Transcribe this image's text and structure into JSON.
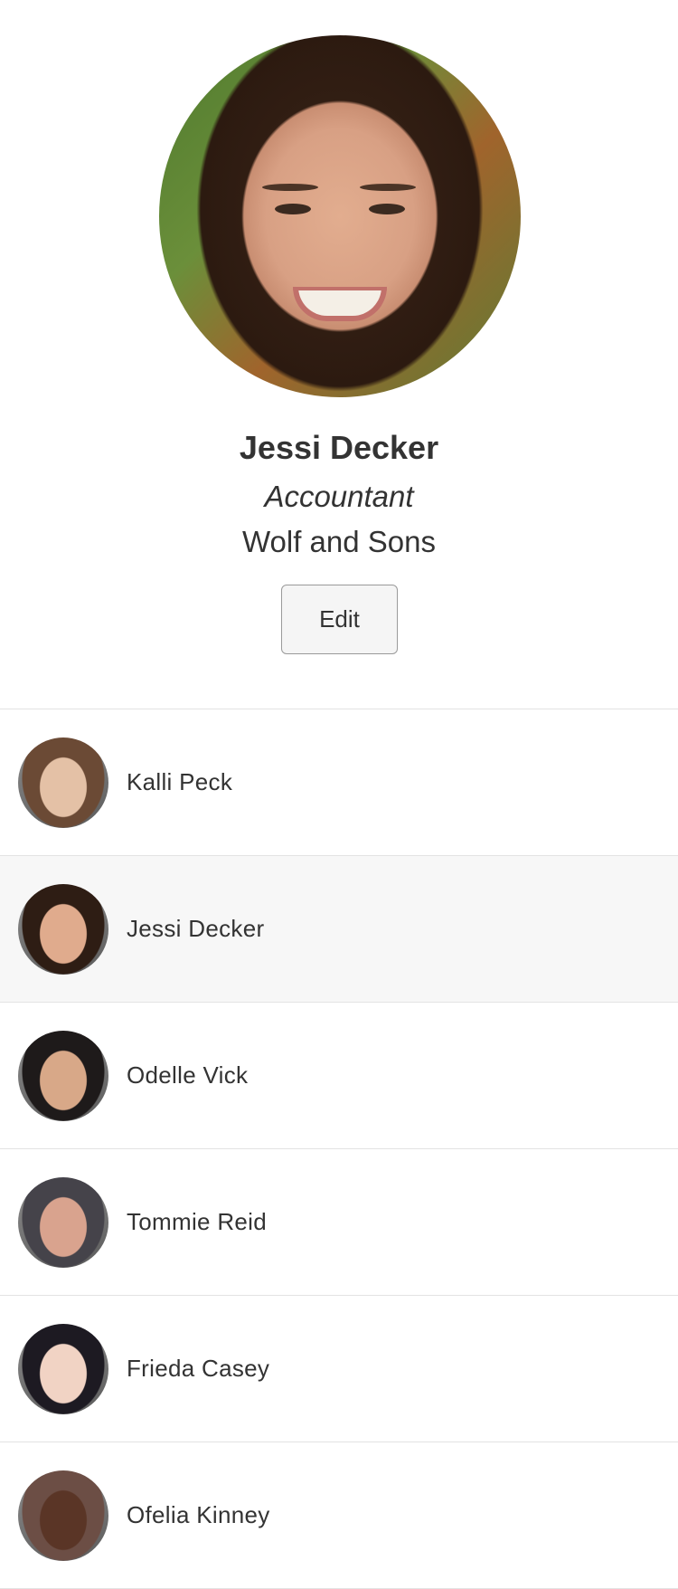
{
  "profile": {
    "name": "Jessi Decker",
    "title": "Accountant",
    "company": "Wolf and Sons",
    "edit_label": "Edit"
  },
  "contacts": [
    {
      "name": "Kalli Peck",
      "selected": false,
      "avatar_colors": [
        "#6b4a35",
        "#e4c1a6"
      ]
    },
    {
      "name": "Jessi Decker",
      "selected": true,
      "avatar_colors": [
        "#2e1d14",
        "#e0ab8d"
      ]
    },
    {
      "name": "Odelle Vick",
      "selected": false,
      "avatar_colors": [
        "#1e1a1a",
        "#d8a888"
      ]
    },
    {
      "name": "Tommie Reid",
      "selected": false,
      "avatar_colors": [
        "#45434a",
        "#d9a38e"
      ]
    },
    {
      "name": "Frieda Casey",
      "selected": false,
      "avatar_colors": [
        "#1d1a22",
        "#f1d3c4"
      ]
    },
    {
      "name": "Ofelia Kinney",
      "selected": false,
      "avatar_colors": [
        "#6c4e45",
        "#5a3526"
      ]
    }
  ]
}
